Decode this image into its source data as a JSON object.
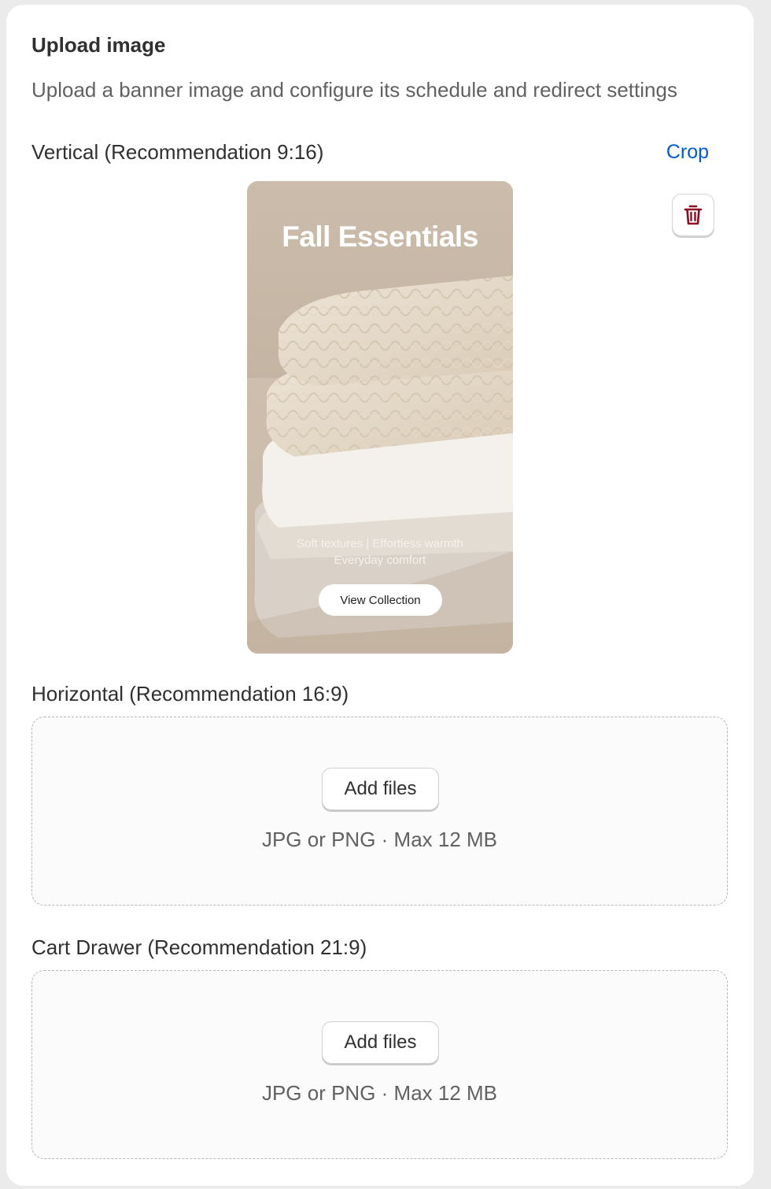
{
  "card": {
    "title": "Upload image",
    "subtitle": "Upload a banner image and configure its schedule and redirect settings"
  },
  "vertical": {
    "label": "Vertical (Recommendation 9:16)",
    "crop_label": "Crop",
    "delete_icon": "trash-icon",
    "preview": {
      "title": "Fall Essentials",
      "subtitle_line1": "Soft textures | Effortless warmth",
      "subtitle_line2": "Everyday comfort",
      "button_label": "View Collection"
    }
  },
  "horizontal": {
    "label": "Horizontal (Recommendation 16:9)",
    "add_label": "Add files",
    "hint": "JPG or PNG · Max 12 MB"
  },
  "cart_drawer": {
    "label": "Cart Drawer (Recommendation 21:9)",
    "add_label": "Add files",
    "hint": "JPG or PNG · Max 12 MB"
  },
  "colors": {
    "link": "#005bd3",
    "danger": "#8e0b21"
  }
}
